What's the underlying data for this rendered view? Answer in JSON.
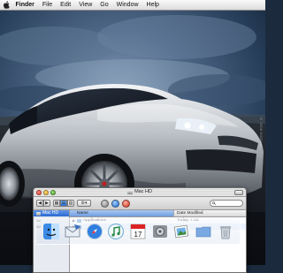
{
  "menubar": {
    "app_name": "Finder",
    "items": [
      "File",
      "Edit",
      "View",
      "Go",
      "Window",
      "Help"
    ]
  },
  "wallpaper": {
    "watermark": "© 2006 NISSAN"
  },
  "finder": {
    "title": "Mac HD",
    "search_placeholder": "",
    "sidebar": [
      {
        "label": "Mac HD",
        "selected": true
      },
      {
        "label": "",
        "selected": false
      },
      {
        "label": "",
        "selected": false
      }
    ],
    "columns": {
      "name": "Name",
      "date": "Date Modified"
    },
    "rows": [
      {
        "name": "Applications",
        "date": "Today, 7:33"
      },
      {
        "name": "",
        "date": ""
      }
    ]
  },
  "dock": {
    "icons": [
      "finder-icon",
      "mail-icon",
      "safari-icon",
      "itunes-icon",
      "ical-icon",
      "system-preferences-icon",
      "iphoto-icon",
      "folder-icon",
      "trash-icon"
    ],
    "ical_date": "17"
  },
  "colors": {
    "selection_blue": "#2c6ad2",
    "menubar": "#e6e6e6",
    "sky": "#1f3550"
  }
}
